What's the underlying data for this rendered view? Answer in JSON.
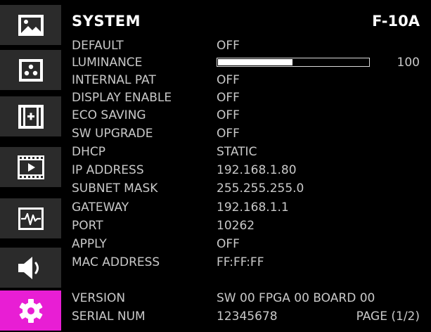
{
  "colors": {
    "accent": "#e81ed4",
    "sidebar_bg": "#2b2b2b"
  },
  "sidebar": {
    "items": [
      {
        "icon": "picture-icon"
      },
      {
        "icon": "pattern-dots-icon"
      },
      {
        "icon": "plus-frame-icon"
      },
      {
        "icon": "film-play-icon"
      },
      {
        "icon": "waveform-icon"
      },
      {
        "icon": "speaker-icon"
      },
      {
        "icon": "gear-icon",
        "active": true
      }
    ]
  },
  "header": {
    "title": "SYSTEM",
    "model": "F-10A"
  },
  "luminance": {
    "label": "LUMINANCE",
    "value": "100",
    "fraction": 0.5
  },
  "rows": [
    {
      "label": "DEFAULT",
      "value": "OFF"
    },
    {
      "label": "INTERNAL PAT",
      "value": "OFF"
    },
    {
      "label": "DISPLAY ENABLE",
      "value": "OFF"
    },
    {
      "label": "ECO SAVING",
      "value": "OFF"
    },
    {
      "label": "SW UPGRADE",
      "value": "OFF"
    },
    {
      "label": "DHCP",
      "value": "STATIC"
    },
    {
      "label": "IP ADDRESS",
      "value": "192.168.1.80"
    },
    {
      "label": "SUBNET MASK",
      "value": "255.255.255.0"
    },
    {
      "label": "GATEWAY",
      "value": "192.168.1.1"
    },
    {
      "label": "PORT",
      "value": "10262"
    },
    {
      "label": "APPLY",
      "value": "OFF"
    },
    {
      "label": "MAC ADDRESS",
      "value": "FF:FF:FF"
    },
    {
      "label": "VERSION",
      "value": "SW 00 FPGA 00 BOARD 00"
    },
    {
      "label": "SERIAL NUM",
      "value": "12345678"
    }
  ],
  "footer": {
    "page": "PAGE (1/2)"
  }
}
